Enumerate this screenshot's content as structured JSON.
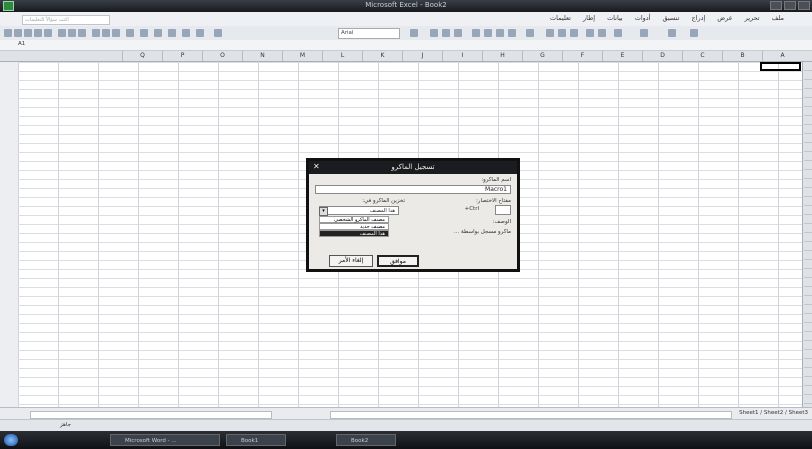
{
  "window": {
    "title": "Microsoft Excel - Book2"
  },
  "menubar": {
    "help_placeholder": "اكتب سؤالاً للتعليمات",
    "menus": [
      "ملف",
      "تحرير",
      "عرض",
      "إدراج",
      "تنسيق",
      "أدوات",
      "بيانات",
      "إطار",
      "تعليمات"
    ]
  },
  "toolbar": {
    "font": "Arial"
  },
  "formula_bar": {
    "name_box": "A1"
  },
  "columns": [
    "A",
    "B",
    "C",
    "D",
    "E",
    "F",
    "G",
    "H",
    "I",
    "J",
    "K",
    "L",
    "M",
    "N",
    "O",
    "P",
    "Q"
  ],
  "sheet_tabs": "Sheet1 / Sheet2 / Sheet3",
  "status": {
    "text": "جاهز"
  },
  "taskbar": {
    "tasks": [
      "Microsoft Word - ...",
      "Book1",
      "Book2"
    ]
  },
  "dialog": {
    "title": "تسجيل الماكرو",
    "macro_name_label": "اسم الماكرو:",
    "macro_name_value": "Macro1",
    "shortcut_label": "مفتاح الاختصار:",
    "shortcut_prefix": "Ctrl+",
    "store_in_label": "تخزين الماكرو في:",
    "store_in_value": "هذا المصنف",
    "options": [
      "مصنف الماكرو الشخصي",
      "مصنف جديد",
      "هذا المصنف"
    ],
    "description_label": "الوصف:",
    "description_value": "ماكرو مسجل بواسطة ...",
    "ok_label": "موافق",
    "cancel_label": "إلغاء الأمر"
  }
}
